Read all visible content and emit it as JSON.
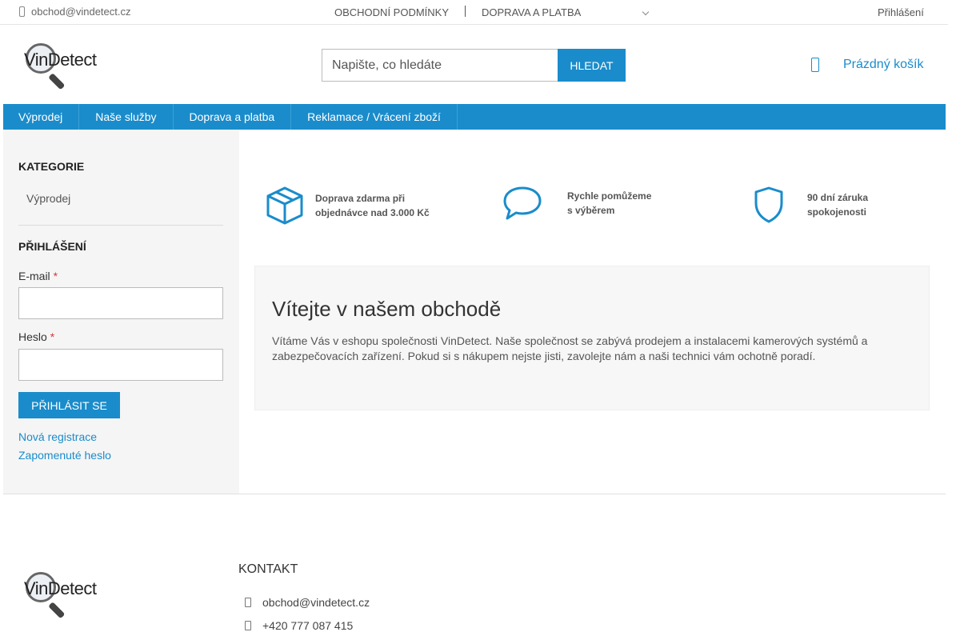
{
  "topbar": {
    "email": "obchod@vindetect.cz",
    "link_terms": "OBCHODNÍ PODMÍNKY",
    "link_shipping": "DOPRAVA A PLATBA",
    "login": "Přihlášení"
  },
  "header": {
    "logo_text": "VinDetect",
    "search_placeholder": "Napište, co hledáte",
    "search_button": "HLEDAT",
    "cart_label": "Prázdný košík"
  },
  "nav": {
    "items": [
      "Výprodej",
      "Naše služby",
      "Doprava a platba",
      "Reklamace / Vrácení zboží"
    ]
  },
  "sidebar": {
    "categories_title": "KATEGORIE",
    "category_item": "Výprodej",
    "login_title": "PŘIHLÁŠENÍ",
    "email_label": "E-mail",
    "password_label": "Heslo",
    "required_mark": "*",
    "login_button": "PŘIHLÁSIT SE",
    "register_link": "Nová registrace",
    "forgot_link": "Zapomenuté heslo"
  },
  "features": [
    {
      "line1": "Doprava zdarma při",
      "line2": "objednávce nad 3.000 Kč",
      "icon": "box-icon"
    },
    {
      "line1": "Rychle pomůžeme",
      "line2": "s výběrem",
      "icon": "chat-bubble-icon"
    },
    {
      "line1": "90 dní záruka",
      "line2": "spokojenosti",
      "icon": "shield-icon"
    }
  ],
  "welcome": {
    "title": "Vítejte v našem obchodě",
    "text": "Vítáme Vás v eshopu společnosti VinDetect. Naše společnost se zabývá prodejem a instalacemi kamerových systémů a zabezpečovacích zařízení. Pokud si s nákupem nejste jisti, zavolejte nám a naši technici vám ochotně poradí."
  },
  "footer": {
    "contact_title": "KONTAKT",
    "email": "obchod@vindetect.cz",
    "phone": "+420 777 087 415"
  },
  "colors": {
    "accent": "#1a8ccb",
    "sidebar_bg": "#f5f5f5"
  }
}
